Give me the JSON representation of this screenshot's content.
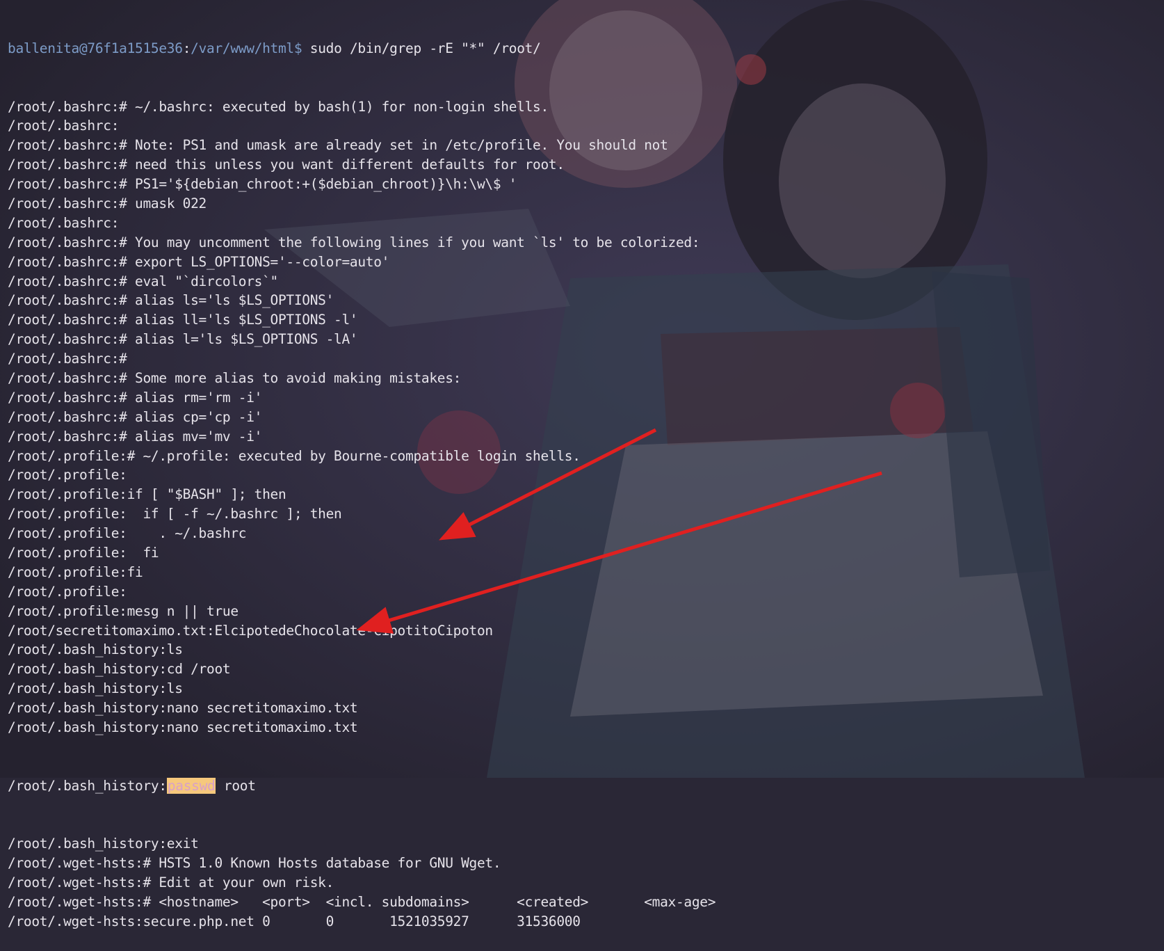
{
  "prompt": {
    "user_host": "ballenita@76f1a1515e36",
    "separator": ":",
    "cwd": "/var/www/html$",
    "command": " sudo /bin/grep -rE \"*\" /root/"
  },
  "output_lines": [
    "/root/.bashrc:# ~/.bashrc: executed by bash(1) for non-login shells.",
    "/root/.bashrc:",
    "/root/.bashrc:# Note: PS1 and umask are already set in /etc/profile. You should not",
    "/root/.bashrc:# need this unless you want different defaults for root.",
    "/root/.bashrc:# PS1='${debian_chroot:+($debian_chroot)}\\h:\\w\\$ '",
    "/root/.bashrc:# umask 022",
    "/root/.bashrc:",
    "/root/.bashrc:# You may uncomment the following lines if you want `ls' to be colorized:",
    "/root/.bashrc:# export LS_OPTIONS='--color=auto'",
    "/root/.bashrc:# eval \"`dircolors`\"",
    "/root/.bashrc:# alias ls='ls $LS_OPTIONS'",
    "/root/.bashrc:# alias ll='ls $LS_OPTIONS -l'",
    "/root/.bashrc:# alias l='ls $LS_OPTIONS -lA'",
    "/root/.bashrc:#",
    "/root/.bashrc:# Some more alias to avoid making mistakes:",
    "/root/.bashrc:# alias rm='rm -i'",
    "/root/.bashrc:# alias cp='cp -i'",
    "/root/.bashrc:# alias mv='mv -i'",
    "/root/.profile:# ~/.profile: executed by Bourne-compatible login shells.",
    "/root/.profile:",
    "/root/.profile:if [ \"$BASH\" ]; then",
    "/root/.profile:  if [ -f ~/.bashrc ]; then",
    "/root/.profile:    . ~/.bashrc",
    "/root/.profile:  fi",
    "/root/.profile:fi",
    "/root/.profile:",
    "/root/.profile:mesg n || true",
    "/root/secretitomaximo.txt:ElcipotedeChocolate-CipotitoCipoton",
    "/root/.bash_history:ls",
    "/root/.bash_history:cd /root",
    "/root/.bash_history:ls",
    "/root/.bash_history:nano secretitomaximo.txt",
    "/root/.bash_history:nano secretitomaximo.txt"
  ],
  "highlight_line": {
    "prefix": "/root/.bash_history:",
    "highlighted": "passwd",
    "suffix": " root"
  },
  "tail_lines": [
    "/root/.bash_history:exit",
    "/root/.wget-hsts:# HSTS 1.0 Known Hosts database for GNU Wget.",
    "/root/.wget-hsts:# Edit at your own risk.",
    "/root/.wget-hsts:# <hostname>   <port>  <incl. subdomains>      <created>       <max-age>",
    "/root/.wget-hsts:secure.php.net 0       0       1521035927      31536000"
  ],
  "colors": {
    "background": "#2a2736",
    "text": "#e6e3ea",
    "prompt_user": "#7d9cc8",
    "highlight_bg": "#f6c87c",
    "arrow": "#e02020"
  }
}
